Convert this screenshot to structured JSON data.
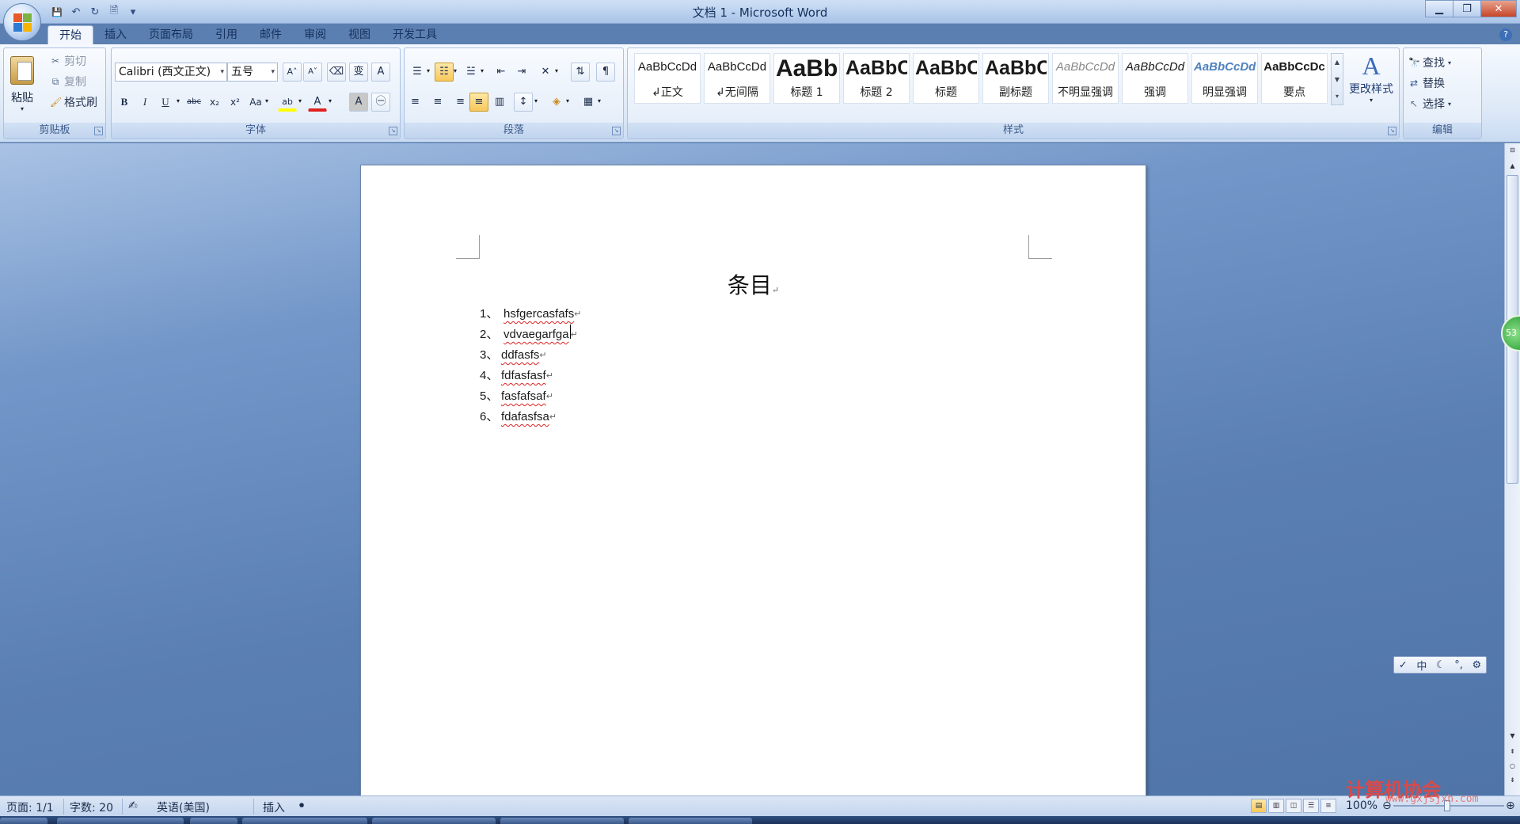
{
  "window": {
    "title": "文档 1 - Microsoft Word",
    "controls": {
      "minimize": "▁",
      "restore": "❐",
      "close": "✕"
    }
  },
  "qat": {
    "save_icon": "💾",
    "undo_icon": "↶",
    "redo_icon": "↻",
    "preview_icon": "🗎",
    "customize_icon": "▾"
  },
  "tabs": [
    {
      "label": "开始",
      "active": true
    },
    {
      "label": "插入"
    },
    {
      "label": "页面布局"
    },
    {
      "label": "引用"
    },
    {
      "label": "邮件"
    },
    {
      "label": "审阅"
    },
    {
      "label": "视图"
    },
    {
      "label": "开发工具"
    }
  ],
  "help_glyph": "?",
  "clipboard": {
    "group_label": "剪贴板",
    "paste": "粘贴",
    "cut": "剪切",
    "copy": "复制",
    "format_painter": "格式刷"
  },
  "font": {
    "group_label": "字体",
    "font_name": "Calibri (西文正文)",
    "font_size": "五号",
    "grow": "A˄",
    "shrink": "A˅",
    "clear": "⌫",
    "phonetic": "变",
    "border_char": "A",
    "bold": "B",
    "italic": "I",
    "underline": "U",
    "strike": "abc",
    "subscript": "x₂",
    "superscript": "x²",
    "case": "Aa",
    "highlight": "ab",
    "font_color": "A",
    "shade_char": "A",
    "enclose": "㊀"
  },
  "paragraph": {
    "group_label": "段落",
    "bullets": "☰",
    "numbering": "☷",
    "multilevel": "☱",
    "decrease_indent": "⇤",
    "increase_indent": "⇥",
    "chinese_layout": "✕",
    "sort": "⇅",
    "show_marks": "¶",
    "align_left": "≡",
    "center": "≡",
    "align_right": "≡",
    "justify": "≡",
    "distributed": "▥",
    "line_spacing": "↕",
    "shading": "◈",
    "borders": "▦"
  },
  "styles": {
    "group_label": "样式",
    "items": [
      {
        "preview": "AaBbCcDd",
        "name": "↲正文"
      },
      {
        "preview": "AaBbCcDd",
        "name": "↲无间隔"
      },
      {
        "preview": "AaBb",
        "name": "标题 1"
      },
      {
        "preview": "AaBbC",
        "name": "标题 2"
      },
      {
        "preview": "AaBbC",
        "name": "标题"
      },
      {
        "preview": "AaBbC",
        "name": "副标题"
      },
      {
        "preview": "AaBbCcDd",
        "name": "不明显强调"
      },
      {
        "preview": "AaBbCcDd",
        "name": "强调"
      },
      {
        "preview": "AaBbCcDd",
        "name": "明显强调"
      },
      {
        "preview": "AaBbCcDc",
        "name": "要点"
      }
    ],
    "change_styles": "更改样式"
  },
  "editing": {
    "group_label": "编辑",
    "find": "查找",
    "replace": "替换",
    "select": "选择"
  },
  "document": {
    "title": "条目",
    "para_mark": "↵",
    "list": [
      {
        "num": "1、",
        "text": "hsfgercasfafs"
      },
      {
        "num": "2、",
        "text": "vdvaegarfga"
      },
      {
        "num": "3、",
        "text": "ddfasfs"
      },
      {
        "num": "4、",
        "text": "fdfasfasf"
      },
      {
        "num": "5、",
        "text": "fasfafsaf"
      },
      {
        "num": "6、",
        "text": "fdafasfsa"
      }
    ]
  },
  "side_badge": "53",
  "ime_bar": [
    "✓",
    "中",
    "☾",
    "°,",
    "⚙"
  ],
  "status": {
    "page": "页面: 1/1",
    "words": "字数: 20",
    "language": "英语(美国)",
    "mode": "插入",
    "zoom": "100%"
  },
  "watermark": {
    "main": "计算机协会",
    "url": "www.gxjsjxh.com"
  },
  "colors": {
    "accent": "#3e6fb6",
    "highlight": "#ffff00",
    "font_color": "#e02020",
    "spell_underline": "#dd2222"
  }
}
